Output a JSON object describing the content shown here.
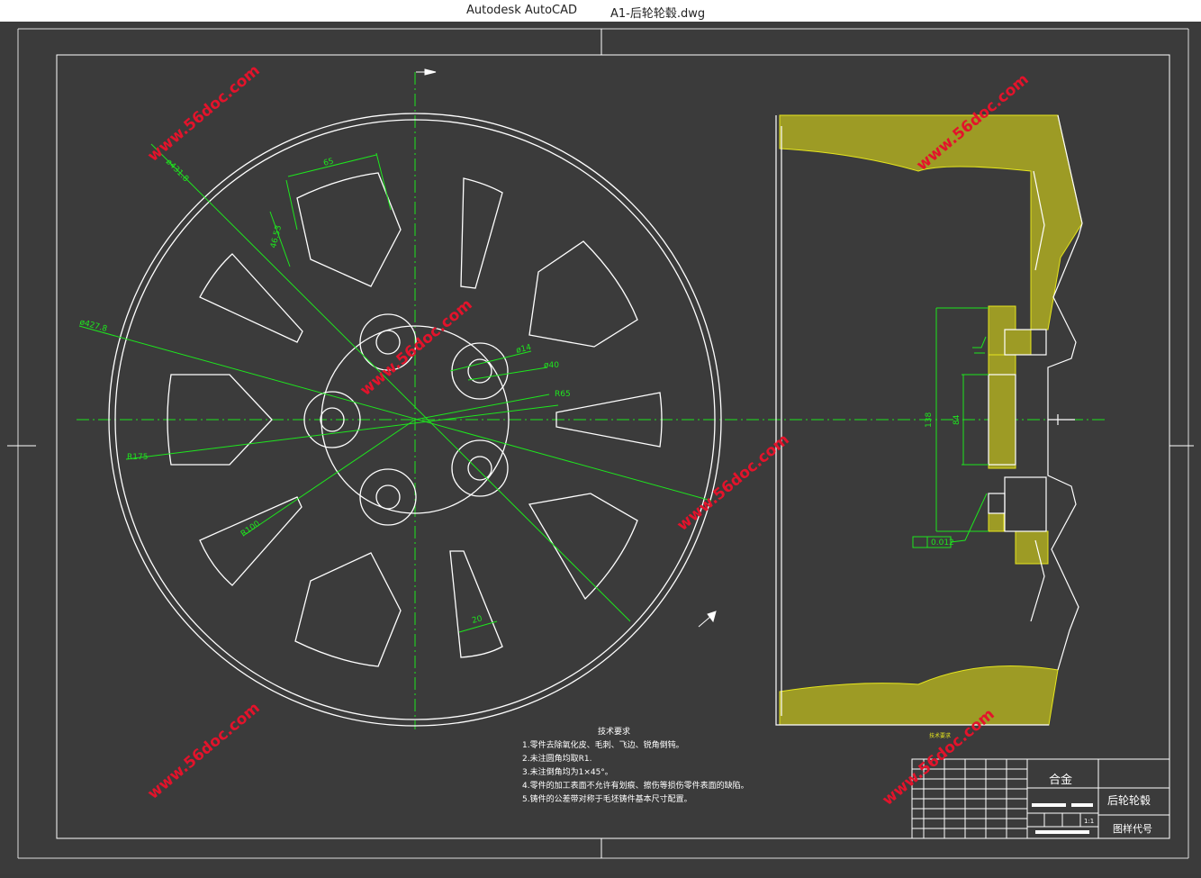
{
  "window": {
    "app_name": "Autodesk AutoCAD",
    "document_title": "A1-后轮轮毂.dwg"
  },
  "colors": {
    "background": "#3b3b3b",
    "geometry": "#ffffff",
    "dimension": "#1ee61e",
    "hatch": "#e6e61e",
    "watermark": "#e3132b"
  },
  "watermark": "www.56doc.com",
  "dimensions": {
    "d1": "65",
    "d2": "46.53",
    "d3": "ø431.8",
    "d4": "ø427.8",
    "d5": "ø14",
    "d6": "ø40",
    "d7": "R65",
    "d8": "R175",
    "d9": "R100",
    "d10": "20",
    "d11": "138",
    "d12": "84",
    "tolerance": "0.012"
  },
  "notes": {
    "title": "技术要求",
    "lines": [
      "1.零件去除氧化皮、毛刺、飞边、锐角倒钝。",
      "2.未注圆角均取R1.",
      "3.未注倒角均为1×45°。",
      "4.零件的加工表面不允许有划痕、擦伤等损伤零件表面的缺陷。",
      "5.铸件的公差带对称于毛坯铸件基本尺寸配置。"
    ],
    "small_label": "技术要求"
  },
  "title_block": {
    "material": "合金",
    "part_name": "后轮轮毂",
    "drawing_no_label": "图样代号",
    "scale": "1:1"
  }
}
